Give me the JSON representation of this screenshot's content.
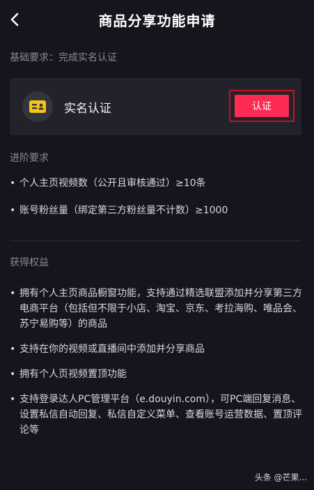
{
  "header": {
    "title": "商品分享功能申请"
  },
  "basic": {
    "label": "基础要求：完成实名认证",
    "card_title": "实名认证",
    "verify_button": "认证"
  },
  "advanced": {
    "label": "进阶要求",
    "items": [
      "个人主页视频数（公开且审核通过）≥10条",
      "账号粉丝量（绑定第三方粉丝量不计数）≥1000"
    ]
  },
  "benefits": {
    "label": "获得权益",
    "items": [
      "拥有个人主页商品橱窗功能，支持通过精选联盟添加并分享第三方电商平台（包括但不限于小店、淘宝、京东、考拉海购、唯品会、苏宁易购等）的商品",
      "支持在你的视频或直播间中添加并分享商品",
      "拥有个人页视频置顶功能",
      "支持登录达人PC管理平台（e.douyin.com），可PC端回复消息、设置私信自动回复、私信自定义菜单、查看账号运营数据、置顶评论等"
    ]
  },
  "watermark": "头条 @芒果...",
  "colors": {
    "background": "#15151d",
    "card": "#22222b",
    "accent": "#fe2c55",
    "highlight_border": "#c8121c",
    "icon": "#f5c518"
  },
  "icons": {
    "back": "chevron-left-icon",
    "id_card": "id-card-icon"
  }
}
